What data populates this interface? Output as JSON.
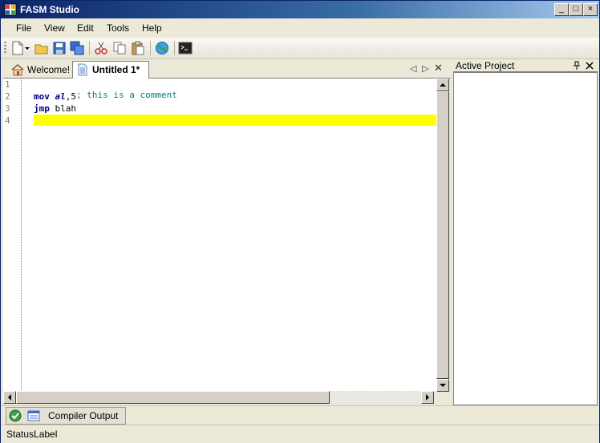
{
  "window": {
    "title": "FASM Studio",
    "minimize": "_",
    "maximize": "□",
    "close": "×"
  },
  "menu": {
    "items": [
      "File",
      "View",
      "Edit",
      "Tools",
      "Help"
    ]
  },
  "tabs": {
    "welcome": "Welcome!",
    "active": "Untitled 1*"
  },
  "editor": {
    "line_numbers": [
      "1",
      "2",
      "3",
      "4"
    ],
    "lines": [
      {
        "comment": "; this is a comment"
      },
      {
        "kw": "mov",
        "reg": "al",
        "rest": ",5"
      },
      {
        "kw": "jmp",
        "rest": " blah"
      }
    ]
  },
  "right_panel": {
    "title": "Active Project"
  },
  "bottom_tab": {
    "label": "Compiler Output"
  },
  "status": {
    "label": "StatusLabel"
  },
  "colors": {
    "comment": "#008080",
    "keyword": "#00008b",
    "register": "#00008b",
    "highlight": "#ffff00"
  }
}
